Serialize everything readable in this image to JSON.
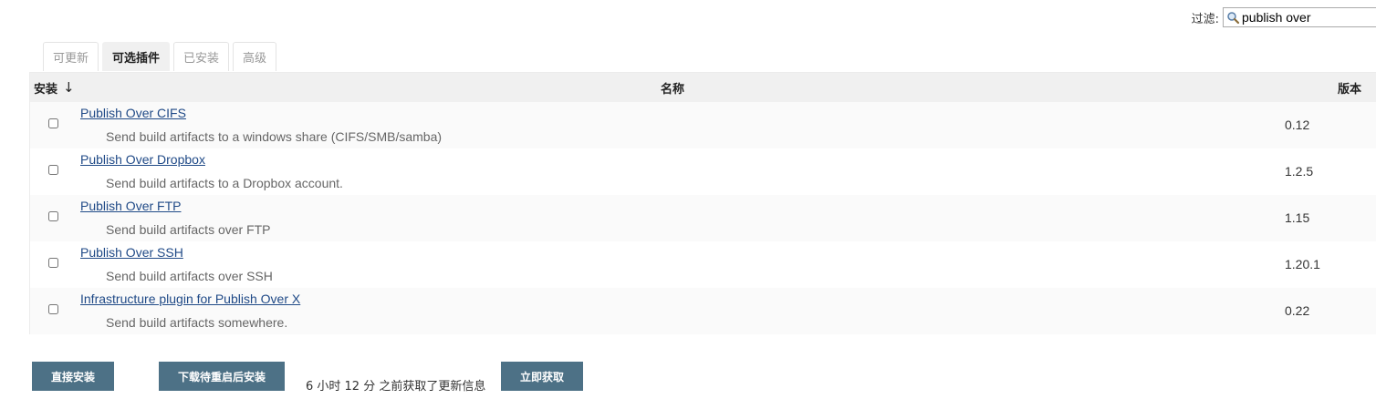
{
  "filter": {
    "label": "过滤:",
    "value": "publish over",
    "icon": "search-icon"
  },
  "tabs": [
    {
      "label": "可更新",
      "active": false
    },
    {
      "label": "可选插件",
      "active": true
    },
    {
      "label": "已安装",
      "active": false
    },
    {
      "label": "高级",
      "active": false
    }
  ],
  "table": {
    "headers": {
      "install": "安装",
      "sort_arrow": "↓",
      "name": "名称",
      "version": "版本"
    },
    "rows": [
      {
        "name": "Publish Over CIFS",
        "description": "Send build artifacts to a windows share (CIFS/SMB/samba)",
        "version": "0.12",
        "checked": false
      },
      {
        "name": "Publish Over Dropbox",
        "description": "Send build artifacts to a Dropbox account.",
        "version": "1.2.5",
        "checked": false
      },
      {
        "name": "Publish Over FTP",
        "description": "Send build artifacts over FTP",
        "version": "1.15",
        "checked": false
      },
      {
        "name": "Publish Over SSH",
        "description": "Send build artifacts over SSH",
        "version": "1.20.1",
        "checked": false
      },
      {
        "name": "Infrastructure plugin for Publish Over X",
        "description": "Send build artifacts somewhere.",
        "version": "0.22",
        "checked": false
      }
    ]
  },
  "footer": {
    "install_now": "直接安装",
    "download_restart": "下载待重启后安装",
    "update_info": "6 小时 12 分 之前获取了更新信息",
    "fetch_now": "立即获取"
  },
  "colors": {
    "button_bg": "#4d7186",
    "link": "#204a87",
    "header_bg": "#f0f0f0"
  }
}
